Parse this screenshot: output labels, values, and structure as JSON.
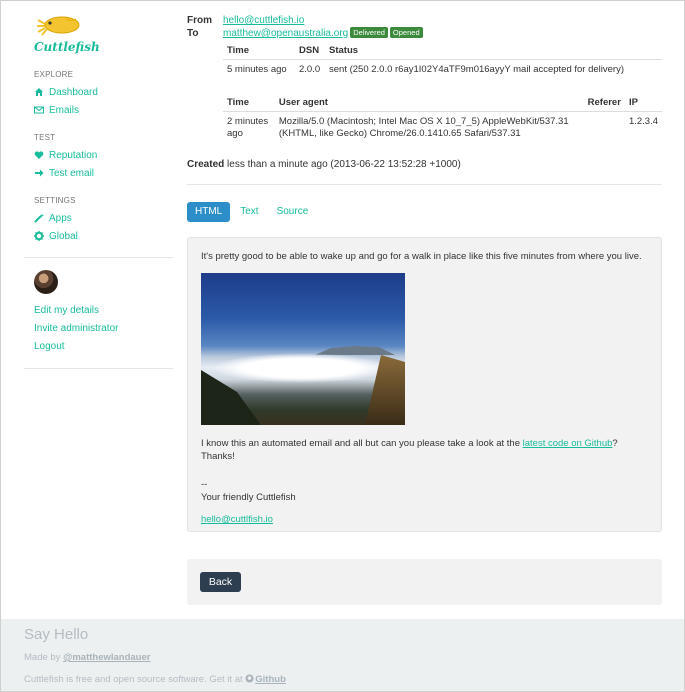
{
  "brand": {
    "name": "Cuttlefish",
    "accent": "#18bc9c"
  },
  "sidebar": {
    "sections": [
      {
        "title": "EXPLORE",
        "items": [
          {
            "label": "Dashboard",
            "icon": "home-icon"
          },
          {
            "label": "Emails",
            "icon": "envelope-icon"
          }
        ]
      },
      {
        "title": "TEST",
        "items": [
          {
            "label": "Reputation",
            "icon": "heart-icon"
          },
          {
            "label": "Test email",
            "icon": "arrow-right-icon"
          }
        ]
      },
      {
        "title": "SETTINGS",
        "items": [
          {
            "label": "Apps",
            "icon": "wand-icon"
          },
          {
            "label": "Global",
            "icon": "cog-icon"
          }
        ]
      }
    ],
    "user_links": [
      "Edit my details",
      "Invite administrator",
      "Logout"
    ]
  },
  "email": {
    "from_label": "From",
    "from": "hello@cuttlefish.io",
    "to_label": "To",
    "to": "matthew@openaustralia.org",
    "badges": [
      "Delivered",
      "Opened"
    ],
    "deliveries": {
      "headers": [
        "Time",
        "DSN",
        "Status"
      ],
      "rows": [
        [
          "5 minutes ago",
          "2.0.0",
          "sent (250 2.0.0 r6ay1I02Y4aTF9m016ayyY mail accepted for delivery)"
        ]
      ]
    },
    "opens": {
      "headers": [
        "Time",
        "User agent",
        "Referer",
        "IP"
      ],
      "rows": [
        [
          "2 minutes ago",
          "Mozilla/5.0 (Macintosh; Intel Mac OS X 10_7_5) AppleWebKit/537.31 (KHTML, like Gecko) Chrome/26.0.1410.65 Safari/537.31",
          "",
          "1.2.3.4"
        ]
      ]
    },
    "created_label": "Created",
    "created_value": "less than a minute ago (2013-06-22 13:52:28 +1000)",
    "tabs": [
      "HTML",
      "Text",
      "Source"
    ],
    "active_tab": "HTML",
    "body": {
      "intro": "It's pretty good to be able to wake up and go for a walk in place like this five minutes from where you live.",
      "request_prefix": "I know this an automated email and all but can you please take a look at the ",
      "request_link": "latest code on Github",
      "request_suffix": "? Thanks!",
      "sig_dash": "--",
      "sig_name": "Your friendly Cuttlefish",
      "sig_email": "hello@cuttlfish.io"
    },
    "back_label": "Back"
  },
  "footer": {
    "title": "Say Hello",
    "made_by_prefix": "Made by ",
    "made_by_link": "@matthewlandauer",
    "oss_prefix": "Cuttlefish is free and open source software. Get it at ",
    "oss_link": "Github"
  }
}
